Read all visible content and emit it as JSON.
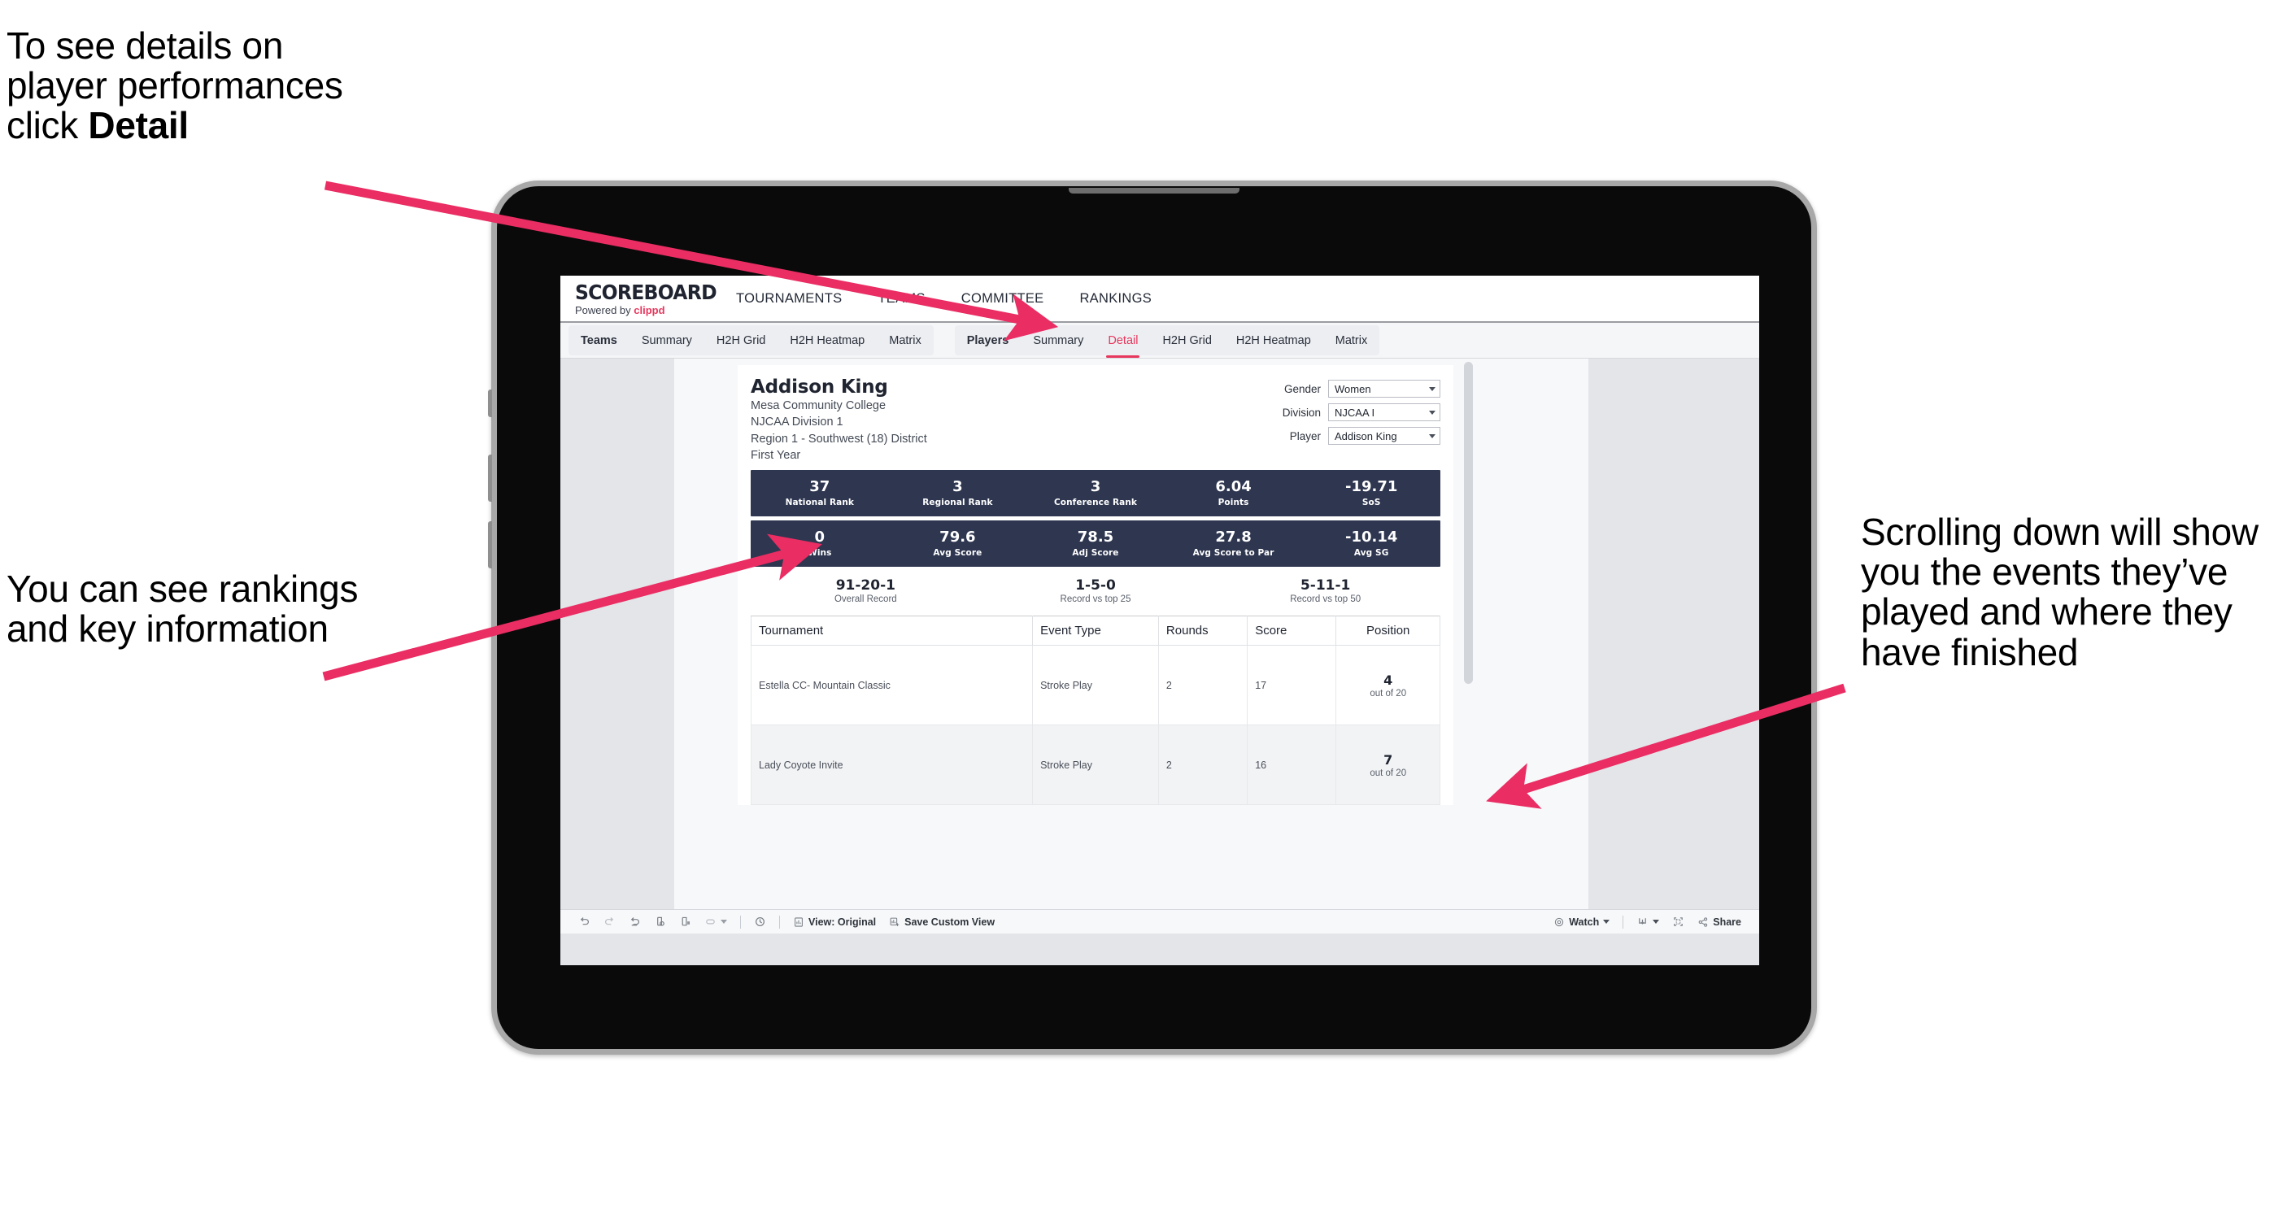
{
  "annotations": {
    "detail_note": {
      "lines": [
        "To see details on",
        "player performances",
        "click "
      ],
      "bold_word": "Detail"
    },
    "rankings_note": "You can see rankings and key information",
    "scroll_note": "Scrolling down will show you the events they’ve played and where they have finished",
    "arrow_color": "#ea2d63"
  },
  "app": {
    "brand": {
      "title": "SCOREBOARD",
      "powered_prefix": "Powered by ",
      "powered_name": "clippd"
    },
    "topnav": [
      "TOURNAMENTS",
      "TEAMS",
      "COMMITTEE",
      "RANKINGS"
    ],
    "subnav": {
      "teams_group": [
        "Teams",
        "Summary",
        "H2H Grid",
        "H2H Heatmap",
        "Matrix"
      ],
      "players_group": [
        "Players",
        "Summary",
        "Detail",
        "H2H Grid",
        "H2H Heatmap",
        "Matrix"
      ],
      "active_tab": "Detail"
    }
  },
  "player": {
    "name": "Addison King",
    "school": "Mesa Community College",
    "division": "NJCAA Division 1",
    "region": "Region 1 - Southwest (18) District",
    "year": "First Year"
  },
  "filters": [
    {
      "label": "Gender",
      "value": "Women"
    },
    {
      "label": "Division",
      "value": "NJCAA I"
    },
    {
      "label": "Player",
      "value": "Addison King"
    }
  ],
  "stat_bands": [
    [
      {
        "value": "37",
        "label": "National Rank"
      },
      {
        "value": "3",
        "label": "Regional Rank"
      },
      {
        "value": "3",
        "label": "Conference Rank"
      },
      {
        "value": "6.04",
        "label": "Points"
      },
      {
        "value": "-19.71",
        "label": "SoS"
      }
    ],
    [
      {
        "value": "0",
        "label": "Wins"
      },
      {
        "value": "79.6",
        "label": "Avg Score"
      },
      {
        "value": "78.5",
        "label": "Adj Score"
      },
      {
        "value": "27.8",
        "label": "Avg Score to Par"
      },
      {
        "value": "-10.14",
        "label": "Avg SG"
      }
    ]
  ],
  "records": [
    {
      "value": "91-20-1",
      "label": "Overall Record"
    },
    {
      "value": "1-5-0",
      "label": "Record vs top 25"
    },
    {
      "value": "5-11-1",
      "label": "Record vs top 50"
    }
  ],
  "tournaments": {
    "columns": [
      "Tournament",
      "Event Type",
      "Rounds",
      "Score",
      "Position"
    ],
    "rows": [
      {
        "tournament": "Estella CC- Mountain Classic",
        "event_type": "Stroke Play",
        "rounds": "2",
        "score": "17",
        "position": "4",
        "position_of": "out of 20"
      },
      {
        "tournament": "Lady Coyote Invite",
        "event_type": "Stroke Play",
        "rounds": "2",
        "score": "16",
        "position": "7",
        "position_of": "out of 20"
      }
    ]
  },
  "toolbar": {
    "view_original": "View: Original",
    "save_custom_view": "Save Custom View",
    "watch": "Watch",
    "share": "Share"
  },
  "colors": {
    "accent": "#e8375c",
    "band_navy": "#2e3650",
    "screen_bg": "#e3e5e9",
    "arrow": "#ea2d63"
  }
}
